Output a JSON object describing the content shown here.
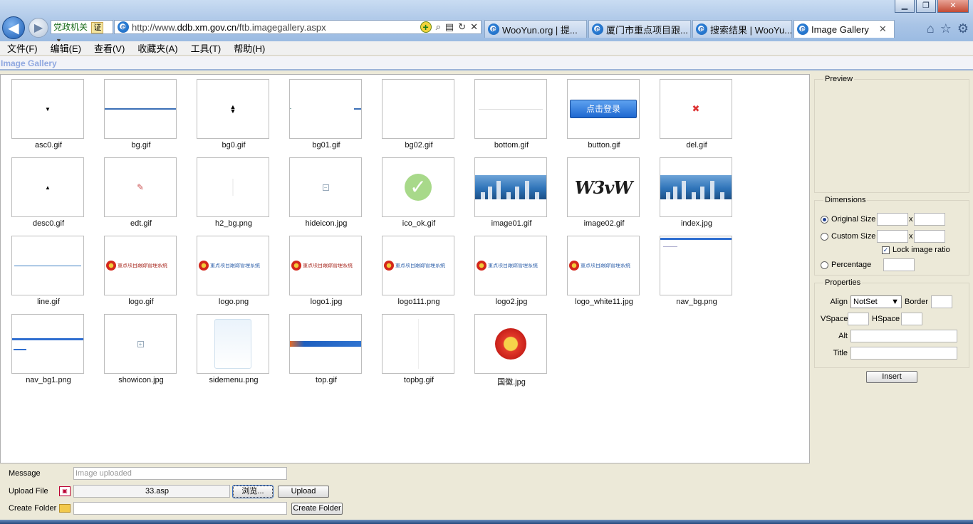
{
  "browser": {
    "window_controls": [
      "▁",
      "❐",
      "✕"
    ],
    "zone_label": "党政机关",
    "zone_badge": "证",
    "url_plain": "http://www.",
    "url_domain": "ddb.xm.gov.cn",
    "url_path": "/ftb.imagegallery.aspx",
    "tabs": [
      {
        "label": "WooYun.org | 提...",
        "active": false
      },
      {
        "label": "厦门市重点项目跟...",
        "active": false
      },
      {
        "label": "搜索结果 | WooYu...",
        "active": false
      },
      {
        "label": "Image Gallery",
        "active": true
      }
    ],
    "tab_close": "✕"
  },
  "menu": [
    "文件(F)",
    "编辑(E)",
    "查看(V)",
    "收藏夹(A)",
    "工具(T)",
    "帮助(H)"
  ],
  "page_title": "Image Gallery",
  "gallery": {
    "items": [
      {
        "name": "asc0.gif",
        "kind": "arrow-up-small"
      },
      {
        "name": "bg.gif",
        "kind": "blue-line"
      },
      {
        "name": "bg0.gif",
        "kind": "updown"
      },
      {
        "name": "bg01.gif",
        "kind": "edges"
      },
      {
        "name": "bg02.gif",
        "kind": "blank"
      },
      {
        "name": "bottom.gif",
        "kind": "grey-line"
      },
      {
        "name": "button.gif",
        "kind": "login-button",
        "text": "点击登录"
      },
      {
        "name": "del.gif",
        "kind": "red-x"
      },
      {
        "name": "desc0.gif",
        "kind": "arrow-up"
      },
      {
        "name": "edt.gif",
        "kind": "pencil"
      },
      {
        "name": "h2_bg.png",
        "kind": "faint"
      },
      {
        "name": "hideicon.jpg",
        "kind": "minus-box"
      },
      {
        "name": "ico_ok.gif",
        "kind": "check"
      },
      {
        "name": "image01.gif",
        "kind": "city"
      },
      {
        "name": "image02.gif",
        "kind": "captcha",
        "text": "W3vW"
      },
      {
        "name": "index.jpg",
        "kind": "city"
      },
      {
        "name": "line.gif",
        "kind": "blue-thin-line"
      },
      {
        "name": "logo.gif",
        "kind": "logo-red",
        "text": "重点项目跟踪管理系统"
      },
      {
        "name": "logo.png",
        "kind": "logo-blue",
        "text": "重点项目跟踪管理系统"
      },
      {
        "name": "logo1.jpg",
        "kind": "logo-red",
        "text": "重点项目跟踪管理系统"
      },
      {
        "name": "logo111.png",
        "kind": "logo-blue",
        "text": "重点项目跟踪管理系统"
      },
      {
        "name": "logo2.jpg",
        "kind": "logo-blue",
        "text": "重点项目跟踪管理系统"
      },
      {
        "name": "logo_white11.jpg",
        "kind": "logo-blue",
        "text": "重点项目跟踪管理系统"
      },
      {
        "name": "nav_bg.png",
        "kind": "nav-bg"
      },
      {
        "name": "nav_bg1.png",
        "kind": "nav-bg1"
      },
      {
        "name": "showicon.jpg",
        "kind": "plus-box"
      },
      {
        "name": "sidemenu.png",
        "kind": "sidemenu"
      },
      {
        "name": "top.gif",
        "kind": "top-bar"
      },
      {
        "name": "topbg.gif",
        "kind": "vline"
      },
      {
        "name": "国徽.jpg",
        "kind": "emblem"
      }
    ]
  },
  "side": {
    "preview_label": "Preview",
    "dimensions_label": "Dimensions",
    "original_size": "Original Size",
    "custom_size": "Custom Size",
    "times": "x",
    "lock_ratio": "Lock image ratio",
    "percentage": "Percentage",
    "properties_label": "Properties",
    "align_label": "Align",
    "align_value": "NotSet",
    "border_label": "Border",
    "vspace_label": "VSpace",
    "hspace_label": "HSpace",
    "alt_label": "Alt",
    "title_label": "Title",
    "insert_button": "Insert"
  },
  "form": {
    "message_label": "Message",
    "message_placeholder": "Image uploaded",
    "upload_label": "Upload File",
    "upload_file_value": "33.asp",
    "browse_button": "浏览...",
    "upload_button": "Upload",
    "folder_label": "Create Folder",
    "create_folder_button": "Create Folder"
  }
}
